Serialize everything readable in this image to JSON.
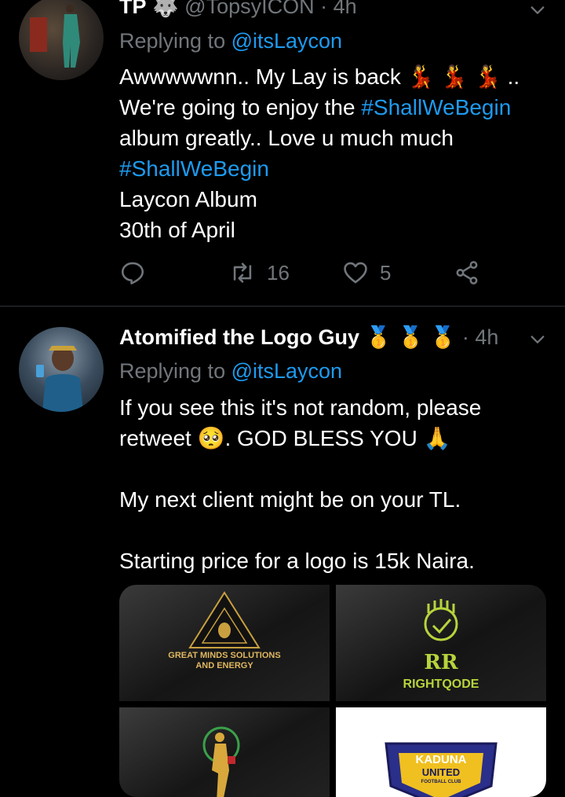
{
  "tweet1": {
    "name": "TP",
    "handle": "@TopsyICON",
    "dot": "·",
    "time": "4h",
    "replying_prefix": "Replying to ",
    "replying_to": "@itsLaycon",
    "text_line1": "Awwwwwnn.. My Lay is back 💃 💃 💃 ..",
    "text_line2a": "We're going to enjoy the ",
    "hashtag1": "#ShallWeBegin",
    "text_line3": "album greatly.. Love u much much",
    "hashtag2": "#ShallWeBegin",
    "text_line5": "Laycon Album",
    "text_line6": "30th of April",
    "actions": {
      "retweets": "16",
      "likes": "5"
    }
  },
  "tweet2": {
    "name": "Atomified the Logo Guy",
    "badges": "🥇 🥇 🥇",
    "dot": "·",
    "time": "4h",
    "replying_prefix": "Replying to ",
    "replying_to": "@itsLaycon",
    "text_line1": "If you see this it's not random, please",
    "text_line2": "retweet 🥺. GOD BLESS YOU 🙏",
    "text_line3": "My next client might be on your TL.",
    "text_line4": "Starting price for a logo is 15k Naira.",
    "media": {
      "logo1_line1": "GREAT MINDS SOLUTIONS",
      "logo1_line2": "AND ENERGY",
      "logo2_mono": "RR",
      "logo2_name": "RIGHTQODE",
      "logo4_line1": "KADUNA",
      "logo4_line2": "UNITED",
      "logo4_line3": "FOOTBALL CLUB"
    }
  },
  "colors": {
    "background": "#000000",
    "accent": "#1d9bf0",
    "muted": "#71767b",
    "text": "#ffffff"
  }
}
